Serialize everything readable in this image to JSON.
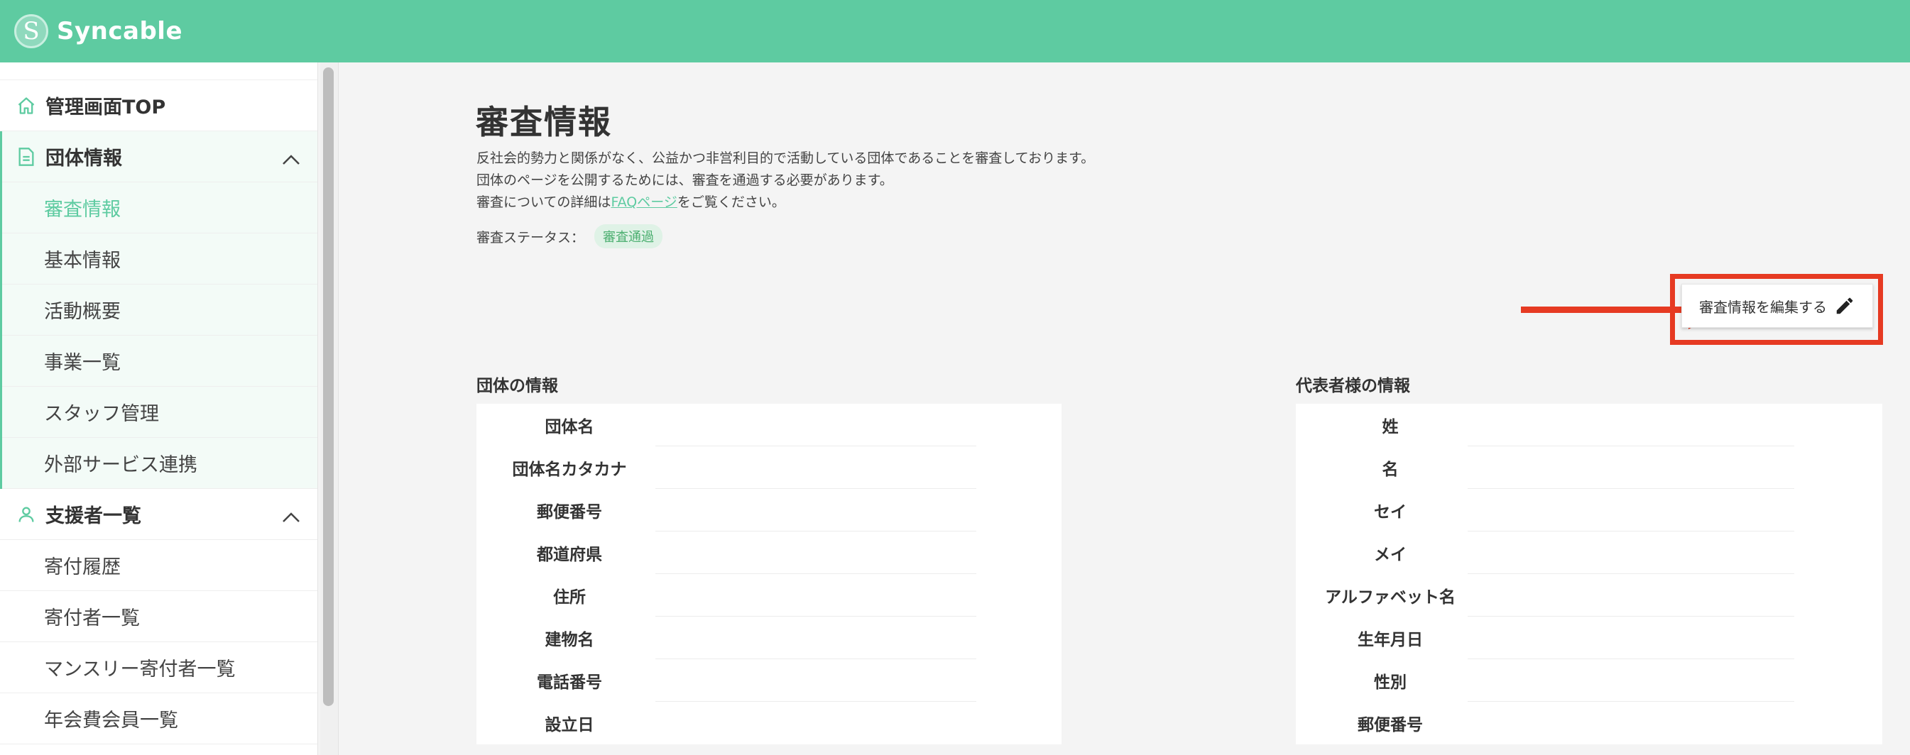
{
  "app": {
    "brand": "Syncable",
    "logo_letter": "S",
    "accent_color": "#5ecba1"
  },
  "sidebar": {
    "top_item": {
      "label": "管理画面TOP",
      "icon": "home-icon"
    },
    "groups": [
      {
        "label": "団体情報",
        "icon": "document-icon",
        "expanded": true,
        "items": [
          {
            "label": "審査情報",
            "active": true
          },
          {
            "label": "基本情報"
          },
          {
            "label": "活動概要"
          },
          {
            "label": "事業一覧"
          },
          {
            "label": "スタッフ管理"
          },
          {
            "label": "外部サービス連携"
          }
        ]
      },
      {
        "label": "支援者一覧",
        "icon": "user-icon",
        "expanded": true,
        "items": [
          {
            "label": "寄付履歴"
          },
          {
            "label": "寄付者一覧"
          },
          {
            "label": "マンスリー寄付者一覧"
          },
          {
            "label": "年会費会員一覧"
          }
        ]
      }
    ]
  },
  "main": {
    "title": "審査情報",
    "description": {
      "line1": "反社会的勢力と関係がなく、公益かつ非営利目的で活動している団体であることを審査しております。",
      "line2": "団体のページを公開するためには、審査を通過する必要があります。",
      "line3_prefix": "審査についての詳細は",
      "line3_link": "FAQページ",
      "line3_suffix": "をご覧ください。"
    },
    "status_label": "審査ステータス：",
    "status_value": "審査通過",
    "edit_button_label": "審査情報を編集する",
    "org_section": {
      "title": "団体の情報",
      "rows": [
        "団体名",
        "団体名カタカナ",
        "郵便番号",
        "都道府県",
        "住所",
        "建物名",
        "電話番号",
        "設立日"
      ]
    },
    "rep_section": {
      "title": "代表者様の情報",
      "rows": [
        "姓",
        "名",
        "セイ",
        "メイ",
        "アルファベット名",
        "生年月日",
        "性別",
        "郵便番号"
      ]
    }
  }
}
